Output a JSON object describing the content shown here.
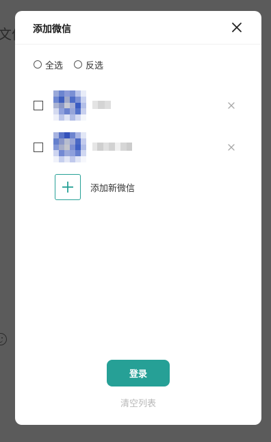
{
  "background": {
    "partial_text": "文件"
  },
  "dialog": {
    "title": "添加微信",
    "close_icon": "close-icon",
    "select_all_label": "全选",
    "invert_select_label": "反选",
    "accounts": [
      {
        "checked": false,
        "avatar": "blurred-avatar",
        "name_hidden": true
      },
      {
        "checked": false,
        "avatar": "blurred-avatar",
        "name_hidden": true
      }
    ],
    "add_label": "添加新微信",
    "login_label": "登录",
    "clear_label": "清空列表"
  },
  "colors": {
    "accent": "#26a096",
    "overlay": "#5b5b5b",
    "muted_text": "#b8b8b8"
  }
}
